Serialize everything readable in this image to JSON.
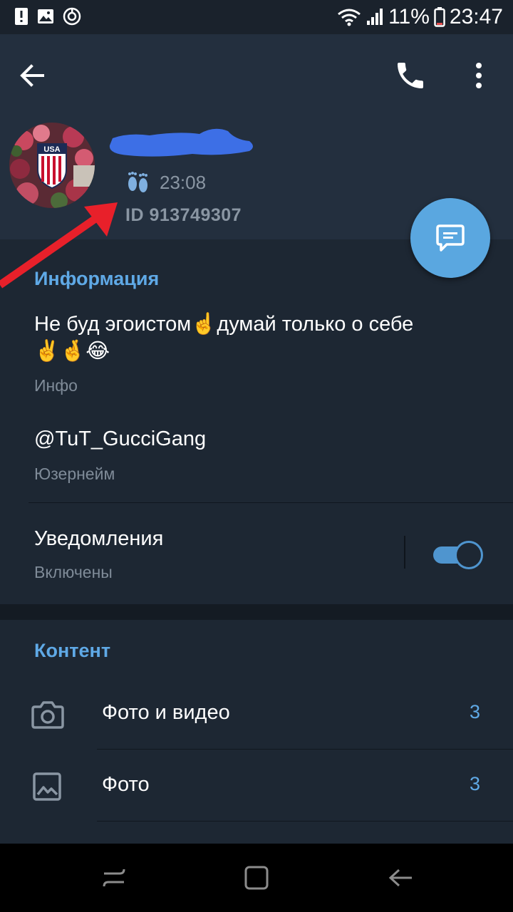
{
  "status_bar": {
    "battery": "11%",
    "time": "23:47",
    "icons": [
      "alert-icon",
      "image-icon",
      "sync-icon",
      "wifi-icon",
      "signal-icon",
      "battery-icon"
    ]
  },
  "toolbar": {
    "icons": [
      "back-arrow-icon",
      "phone-icon",
      "more-vertical-icon"
    ]
  },
  "profile": {
    "last_seen": "23:08",
    "user_id": "ID 913749307",
    "avatar_icon": "usa-crest-avatar",
    "name_redacted_color": "#3d6fe6"
  },
  "info": {
    "section_title": "Информация",
    "bio_line1": "Не буд эгоистом☝️думай только о себе",
    "bio_line2": "✌️🤞😂",
    "bio_caption": "Инфо",
    "username": "@TuT_GucciGang",
    "username_caption": "Юзернейм",
    "notifications_title": "Уведомления",
    "notifications_status": "Включены",
    "notifications_enabled": true
  },
  "content": {
    "section_title": "Контент",
    "items": [
      {
        "icon": "camera-icon",
        "label": "Фото и видео",
        "count": "3"
      },
      {
        "icon": "photo-icon",
        "label": "Фото",
        "count": "3"
      }
    ]
  },
  "nav_bar": {
    "icons": [
      "recents-icon",
      "home-icon",
      "back-icon"
    ]
  },
  "colors": {
    "accent": "#5fa9e6",
    "fab": "#5aa7e0",
    "header_bg": "#232f3e",
    "body_bg": "#1d2733",
    "annotation_arrow": "#e8202a"
  }
}
